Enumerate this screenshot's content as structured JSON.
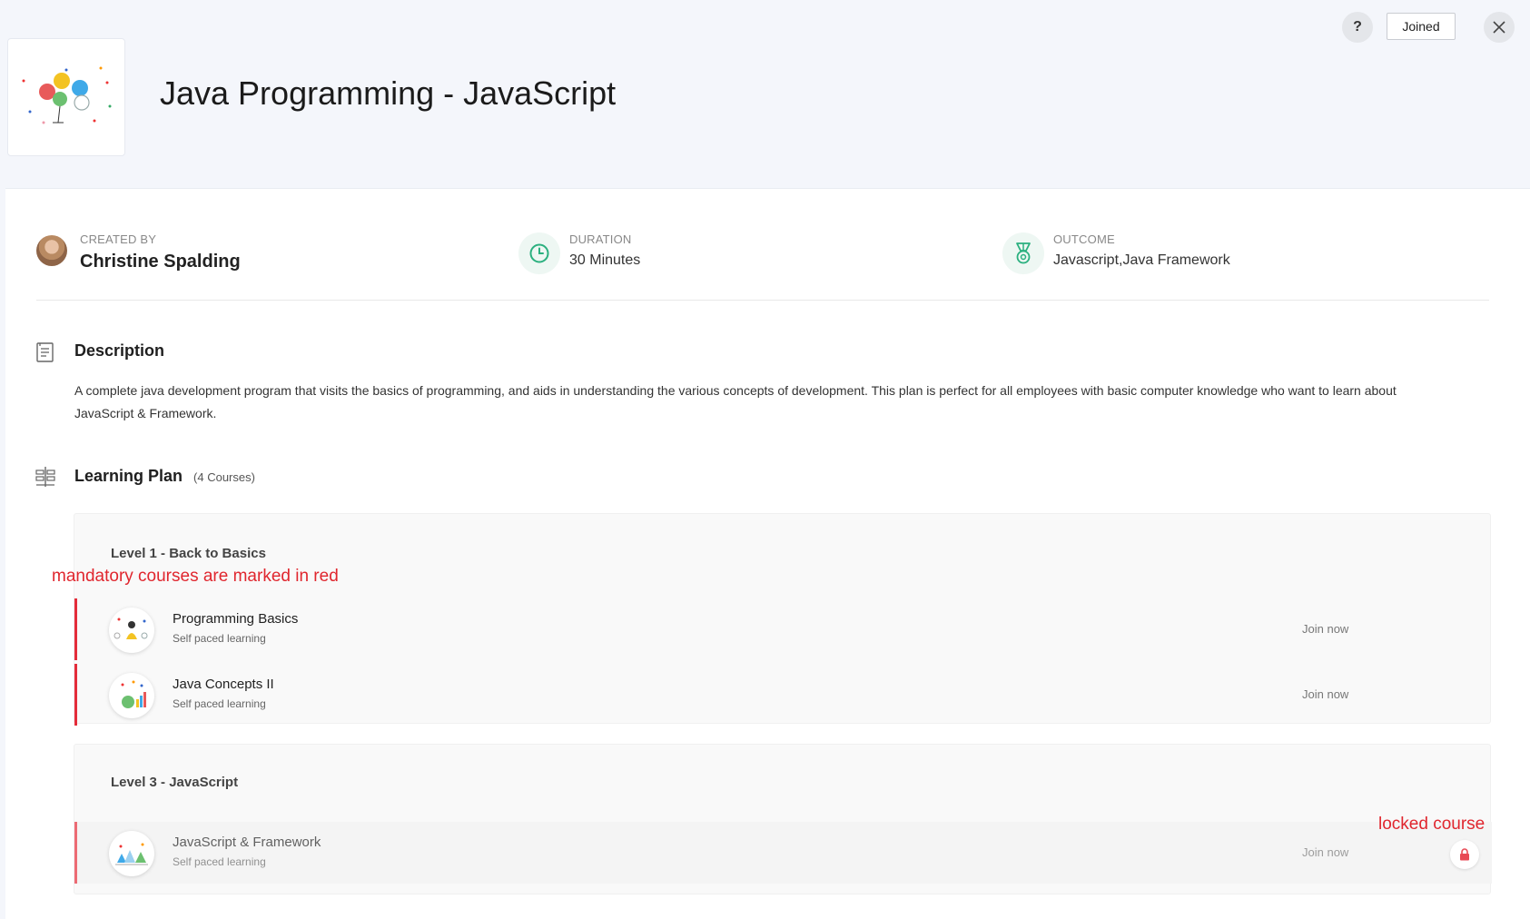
{
  "header": {
    "title": "Java Programming - JavaScript",
    "help_label": "?",
    "joined_label": "Joined"
  },
  "meta": {
    "created_by": {
      "label": "CREATED BY",
      "value": "Christine Spalding"
    },
    "duration": {
      "label": "DURATION",
      "value": "30 Minutes"
    },
    "outcome": {
      "label": "OUTCOME",
      "value": "Javascript,Java Framework"
    }
  },
  "description": {
    "title": "Description",
    "text": "A complete java development program that visits the basics of programming, and aids in understanding the various concepts of development. This plan is perfect for all employees with basic computer knowledge who want to learn about JavaScript & Framework."
  },
  "learning_plan": {
    "title": "Learning Plan",
    "count": "(4 Courses)",
    "levels": [
      {
        "title": "Level 1 - Back to Basics",
        "courses": [
          {
            "name": "Programming Basics",
            "type": "Self paced learning",
            "action": "Join now"
          },
          {
            "name": "Java Concepts II",
            "type": "Self paced learning",
            "action": "Join now"
          }
        ]
      },
      {
        "title": "Level 3 - JavaScript",
        "courses": [
          {
            "name": "JavaScript & Framework",
            "type": "Self paced learning",
            "action": "Join now"
          }
        ]
      }
    ]
  },
  "annotations": {
    "mandatory": "mandatory courses are marked in red",
    "locked": "locked course"
  },
  "colors": {
    "mandatory_bar": "#e42c3a",
    "annotation": "#e0262e",
    "meta_icon": "#2bb07f"
  }
}
